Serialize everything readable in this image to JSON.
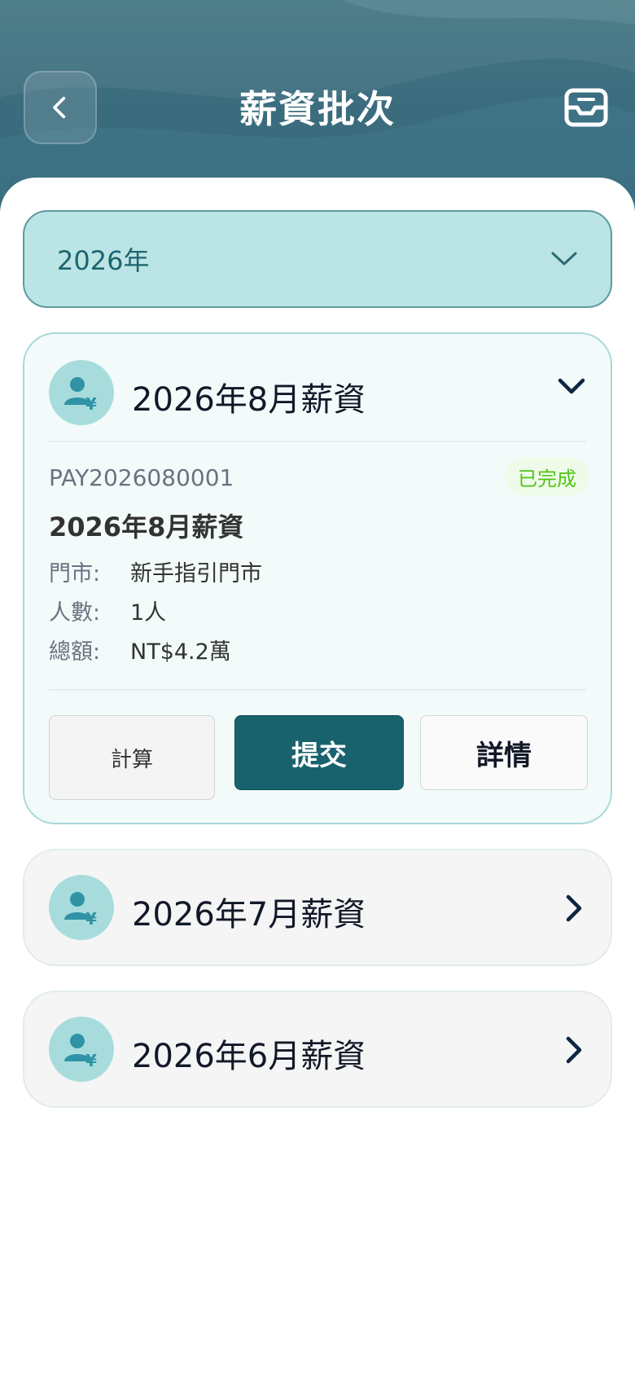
{
  "header": {
    "title": "薪資批次",
    "back_icon": "chevron-left-icon",
    "inbox_icon": "inbox-icon"
  },
  "year_filter": {
    "selected": "2026年",
    "icon": "chevron-down-icon"
  },
  "batches": [
    {
      "title": "2026年8月薪資",
      "expanded": true,
      "id": "PAY2026080001",
      "status": "已完成",
      "detail_title": "2026年8月薪資",
      "fields": [
        {
          "label": "門市:",
          "value": "新手指引門市"
        },
        {
          "label": "人數:",
          "value": "1人"
        },
        {
          "label": "總額:",
          "value": "NT$4.2萬"
        }
      ],
      "actions": {
        "calculate": "計算",
        "submit": "提交",
        "details": "詳情"
      }
    },
    {
      "title": "2026年7月薪資",
      "expanded": false
    },
    {
      "title": "2026年6月薪資",
      "expanded": false
    }
  ],
  "colors": {
    "header": "#3f7386",
    "primary": "#18626d",
    "select_bg": "#bbe4e4",
    "avatar_bg": "#a8dcdc",
    "status_green": "#52c41a"
  }
}
